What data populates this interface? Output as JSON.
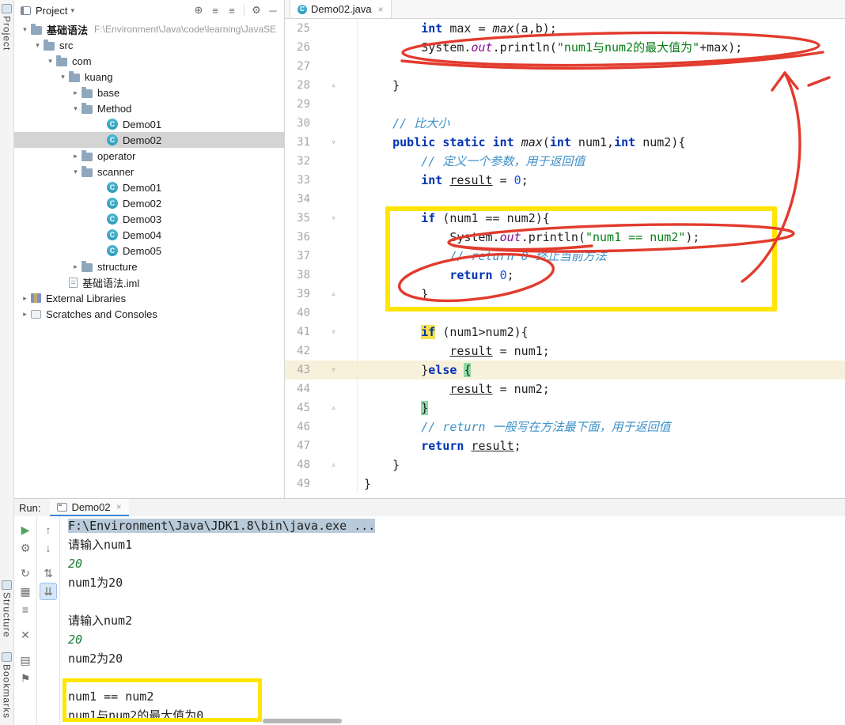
{
  "colors": {
    "annotation_red": "#E23B2E",
    "annotation_yellow": "#FFE500",
    "keyword": "#0033B3",
    "string": "#067D17",
    "number": "#1750EB",
    "comment": "#3C90C8",
    "field": "#871094",
    "selection_gray": "#D4D4D4",
    "console_selection": "#B9CBDA",
    "caret_line": "#F7F0DA",
    "if_highlight": "#F5E14B",
    "brace_highlight": "#8FDAA5",
    "tab_underline": "#3E86D1",
    "input_green": "#1B7F37",
    "run_green": "#4FA65A"
  },
  "stripe": {
    "project": "Project",
    "structure": "Structure",
    "bookmarks": "Bookmarks"
  },
  "project_panel": {
    "header": {
      "title": "Project",
      "caret": "▾",
      "icons": [
        {
          "name": "locate-file-button",
          "glyph": "⊕"
        },
        {
          "name": "expand-all-button",
          "glyph": "≡"
        },
        {
          "name": "collapse-all-button",
          "glyph": "≡"
        },
        {
          "divider": true
        },
        {
          "name": "settings-gear-button",
          "glyph": "⚙"
        },
        {
          "name": "hide-panel-button",
          "glyph": "─"
        }
      ]
    },
    "tree": [
      {
        "label": "基础语法",
        "sublabel": "F:\\Environment\\Java\\code\\learning\\JavaSE",
        "level": 0,
        "chevron": "open",
        "icon": "folder",
        "bold": true
      },
      {
        "label": "src",
        "level": 1,
        "chevron": "open",
        "icon": "folder"
      },
      {
        "label": "com",
        "level": 2,
        "chevron": "open",
        "icon": "folder"
      },
      {
        "label": "kuang",
        "level": 3,
        "chevron": "open",
        "icon": "folder"
      },
      {
        "label": "base",
        "level": 4,
        "chevron": "closed",
        "icon": "folder"
      },
      {
        "label": "Method",
        "level": 4,
        "chevron": "open",
        "icon": "folder"
      },
      {
        "label": "Demo01",
        "level": 5,
        "leaf": true,
        "icon": "class"
      },
      {
        "label": "Demo02",
        "level": 5,
        "leaf": true,
        "icon": "class",
        "selected": true
      },
      {
        "label": "operator",
        "level": 4,
        "chevron": "closed",
        "icon": "folder"
      },
      {
        "label": "scanner",
        "level": 4,
        "chevron": "open",
        "icon": "folder"
      },
      {
        "label": "Demo01",
        "level": 5,
        "leaf": true,
        "icon": "class"
      },
      {
        "label": "Demo02",
        "level": 5,
        "leaf": true,
        "icon": "class"
      },
      {
        "label": "Demo03",
        "level": 5,
        "leaf": true,
        "icon": "class"
      },
      {
        "label": "Demo04",
        "level": 5,
        "leaf": true,
        "icon": "class"
      },
      {
        "label": "Demo05",
        "level": 5,
        "leaf": true,
        "icon": "class"
      },
      {
        "label": "structure",
        "level": 4,
        "chevron": "closed",
        "icon": "folder"
      },
      {
        "label": "基础语法.iml",
        "level": 2,
        "leaf": true,
        "icon": "file"
      },
      {
        "label": "External Libraries",
        "level": 0,
        "chevron": "closed",
        "icon": "lib"
      },
      {
        "label": "Scratches and Consoles",
        "level": 0,
        "chevron": "closed",
        "icon": "scratch"
      }
    ]
  },
  "editor": {
    "tab": {
      "label": "Demo02.java",
      "close": "×"
    },
    "lines": [
      {
        "n": 25,
        "seg": [
          [
            "p",
            "        "
          ],
          [
            "k",
            "int"
          ],
          [
            "p",
            " max = "
          ],
          [
            "m",
            "max"
          ],
          [
            "p",
            "(a,b);"
          ]
        ]
      },
      {
        "n": 26,
        "seg": [
          [
            "p",
            "        System."
          ],
          [
            "f",
            "out"
          ],
          [
            "p",
            ".println("
          ],
          [
            "s",
            "\"num1与num2的最大值为\""
          ],
          [
            "p",
            "+max);"
          ]
        ]
      },
      {
        "n": 27,
        "seg": []
      },
      {
        "n": 28,
        "seg": [
          [
            "p",
            "    }"
          ]
        ],
        "fold": "end"
      },
      {
        "n": 29,
        "seg": []
      },
      {
        "n": 30,
        "seg": [
          [
            "p",
            "    "
          ],
          [
            "c",
            "// 比大小"
          ]
        ]
      },
      {
        "n": 31,
        "seg": [
          [
            "p",
            "    "
          ],
          [
            "k",
            "public"
          ],
          [
            "p",
            " "
          ],
          [
            "k",
            "static"
          ],
          [
            "p",
            " "
          ],
          [
            "k",
            "int"
          ],
          [
            "p",
            " "
          ],
          [
            "m",
            "max"
          ],
          [
            "p",
            "("
          ],
          [
            "k",
            "int"
          ],
          [
            "p",
            " num1,"
          ],
          [
            "k",
            "int"
          ],
          [
            "p",
            " num2){"
          ]
        ],
        "fold": "start"
      },
      {
        "n": 32,
        "seg": [
          [
            "p",
            "        "
          ],
          [
            "c",
            "// 定义一个参数，用于返回值"
          ]
        ]
      },
      {
        "n": 33,
        "seg": [
          [
            "p",
            "        "
          ],
          [
            "k",
            "int"
          ],
          [
            "p",
            " "
          ],
          [
            "u",
            "result"
          ],
          [
            "p",
            " = "
          ],
          [
            "n2",
            "0"
          ],
          [
            "p",
            ";"
          ]
        ]
      },
      {
        "n": 34,
        "seg": []
      },
      {
        "n": 35,
        "seg": [
          [
            "p",
            "        "
          ],
          [
            "k",
            "if"
          ],
          [
            "p",
            " (num1 == num2){"
          ]
        ],
        "fold": "start"
      },
      {
        "n": 36,
        "seg": [
          [
            "p",
            "            System."
          ],
          [
            "f",
            "out"
          ],
          [
            "p",
            ".println("
          ],
          [
            "s",
            "\"num1 == num2\""
          ],
          [
            "p",
            ");"
          ]
        ]
      },
      {
        "n": 37,
        "seg": [
          [
            "p",
            "            "
          ],
          [
            "c",
            "// return 0 终止当前方法"
          ]
        ]
      },
      {
        "n": 38,
        "seg": [
          [
            "p",
            "            "
          ],
          [
            "k",
            "return"
          ],
          [
            "p",
            " "
          ],
          [
            "n2",
            "0"
          ],
          [
            "p",
            ";"
          ]
        ]
      },
      {
        "n": 39,
        "seg": [
          [
            "p",
            "        }"
          ]
        ],
        "fold": "end"
      },
      {
        "n": 40,
        "seg": []
      },
      {
        "n": 41,
        "seg": [
          [
            "p",
            "        "
          ],
          [
            "khl",
            "if"
          ],
          [
            "p",
            " (num1>num2){"
          ]
        ],
        "fold": "start"
      },
      {
        "n": 42,
        "seg": [
          [
            "p",
            "            "
          ],
          [
            "u",
            "result"
          ],
          [
            "p",
            " = num1;"
          ]
        ]
      },
      {
        "n": 43,
        "seg": [
          [
            "p",
            "        }"
          ],
          [
            "k",
            "else"
          ],
          [
            "p",
            " "
          ],
          [
            "ghl",
            "{"
          ]
        ],
        "fold": "start",
        "caret": true
      },
      {
        "n": 44,
        "seg": [
          [
            "p",
            "            "
          ],
          [
            "u",
            "result"
          ],
          [
            "p",
            " = num2;"
          ]
        ]
      },
      {
        "n": 45,
        "seg": [
          [
            "p",
            "        "
          ],
          [
            "ghl",
            "}"
          ]
        ],
        "fold": "end"
      },
      {
        "n": 46,
        "seg": [
          [
            "p",
            "        "
          ],
          [
            "c",
            "// return 一般写在方法最下面，用于返回值"
          ]
        ]
      },
      {
        "n": 47,
        "seg": [
          [
            "p",
            "        "
          ],
          [
            "k",
            "return"
          ],
          [
            "p",
            " "
          ],
          [
            "u",
            "result"
          ],
          [
            "p",
            ";"
          ]
        ]
      },
      {
        "n": 48,
        "seg": [
          [
            "p",
            "    }"
          ]
        ],
        "fold": "end"
      },
      {
        "n": 49,
        "seg": [
          [
            "p",
            "}"
          ]
        ]
      }
    ]
  },
  "run_panel": {
    "label": "Run:",
    "tab": {
      "label": "Demo02",
      "close": "×"
    },
    "toolbar_main": [
      {
        "name": "rerun-button",
        "glyph": "▶",
        "color": "#4FA65A"
      },
      {
        "name": "wrench-settings-button",
        "glyph": "⚙"
      },
      {
        "name": "rerun-failed-tests-button",
        "glyph": "↻",
        "gap": true
      },
      {
        "name": "coverage-button",
        "glyph": "▦"
      },
      {
        "name": "print-button",
        "glyph": "≡"
      },
      {
        "name": "clear-all-button",
        "glyph": "✕",
        "gap": true
      },
      {
        "name": "restore-layout-button",
        "glyph": "▤",
        "gap": true
      },
      {
        "name": "pin-tab-button",
        "glyph": "⚑"
      }
    ],
    "toolbar_console": [
      {
        "name": "up-stacktrace-button",
        "glyph": "↑"
      },
      {
        "name": "down-stacktrace-button",
        "glyph": "↓"
      },
      {
        "name": "soft-wrap-button",
        "glyph": "⇅",
        "gap": true
      },
      {
        "name": "scroll-to-end-button",
        "glyph": "⇊",
        "active": true
      }
    ],
    "console_lines": [
      {
        "sel": true,
        "seg": [
          [
            "p",
            "F:\\Environment\\Java\\JDK1.8\\bin\\java.exe ..."
          ]
        ]
      },
      {
        "seg": [
          [
            "p",
            "请输入num1"
          ]
        ]
      },
      {
        "seg": [
          [
            "g",
            "20"
          ]
        ]
      },
      {
        "seg": [
          [
            "p",
            "num1为20"
          ]
        ]
      },
      {
        "seg": []
      },
      {
        "seg": [
          [
            "p",
            "请输入num2"
          ]
        ]
      },
      {
        "seg": [
          [
            "g",
            "20"
          ]
        ]
      },
      {
        "seg": [
          [
            "p",
            "num2为20"
          ]
        ]
      },
      {
        "seg": []
      },
      {
        "seg": [
          [
            "p",
            "num1 == num2"
          ]
        ]
      },
      {
        "seg": [
          [
            "p",
            "num1与num2的最大值为0"
          ]
        ]
      }
    ]
  }
}
